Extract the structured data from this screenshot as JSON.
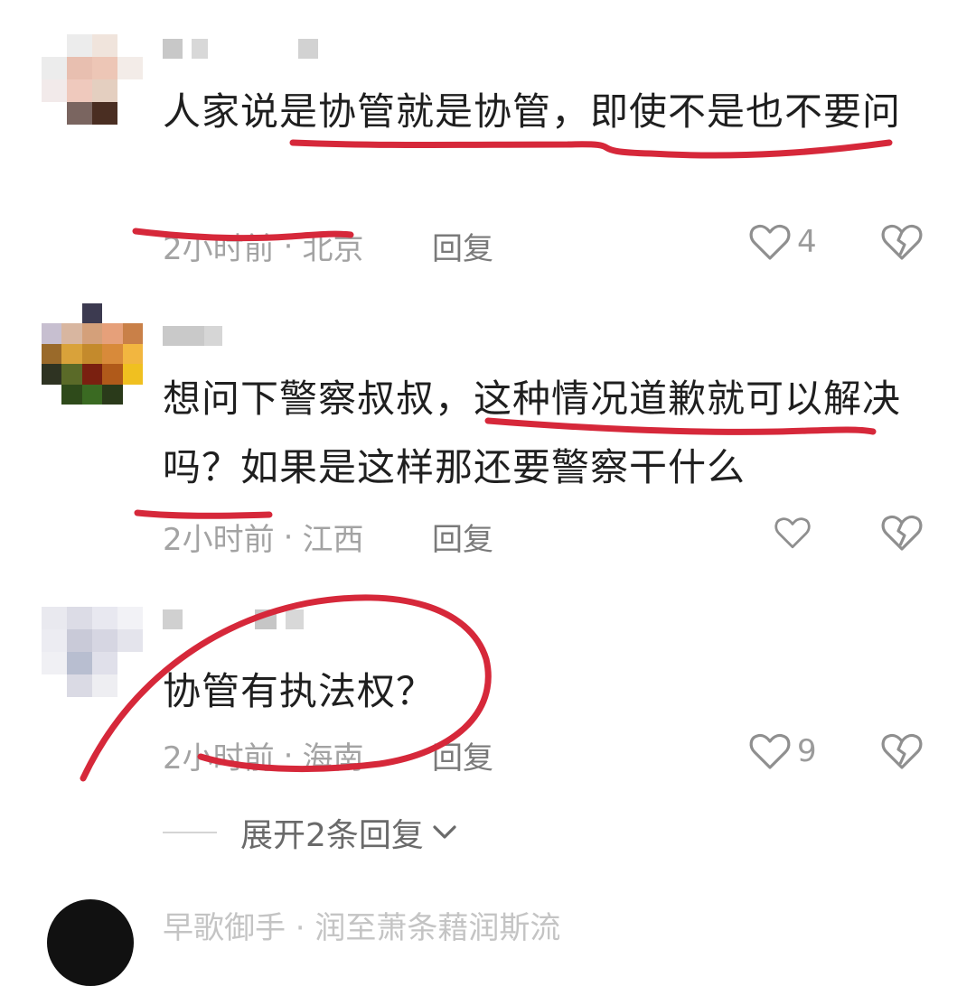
{
  "comments": [
    {
      "text": "人家说是协管就是协管，即使不是也不要问",
      "time": "2小时前",
      "location": "北京",
      "reply_label": "回复",
      "likes": "4"
    },
    {
      "text": "想问下警察叔叔，这种情况道歉就可以解决吗？如果是这样那还要警察干什么",
      "time": "2小时前",
      "location": "江西",
      "reply_label": "回复",
      "likes": ""
    },
    {
      "text": "协管有执法权？",
      "time": "2小时前",
      "location": "海南",
      "reply_label": "回复",
      "likes": "9"
    }
  ],
  "expand_replies": "展开2条回复",
  "next_comment": {
    "username": "早歌御手 · 润至萧条藉润斯流"
  },
  "colors": {
    "annotation": "#d6283a",
    "meta_text": "#a3a3a3",
    "body_text": "#1f1f1f"
  },
  "icons": [
    "heart-outline-icon",
    "broken-heart-icon",
    "chevron-down-icon"
  ]
}
